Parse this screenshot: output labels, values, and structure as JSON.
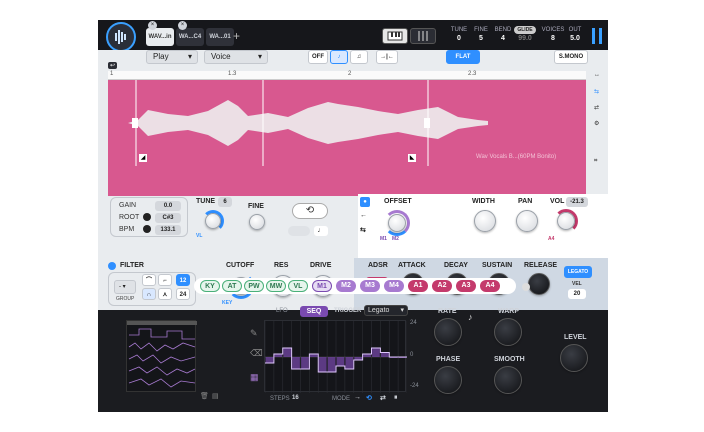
{
  "header": {
    "tabs": [
      {
        "label": "WAV...in",
        "active": true
      },
      {
        "label": "WA...C4",
        "active": false
      },
      {
        "label": "WA...01",
        "active": false
      }
    ],
    "add_label": "+",
    "params": [
      {
        "label": "TUNE",
        "value": "0"
      },
      {
        "label": "FINE",
        "value": "5"
      },
      {
        "label": "BEND",
        "value": "4"
      },
      {
        "label": "VOICES",
        "value": "8"
      },
      {
        "label": "OUT",
        "value": "5.0"
      }
    ],
    "glide_label": "GLIDE",
    "glide_value": "99.0"
  },
  "controls": {
    "play_mode": "Play",
    "voice_mode": "Voice",
    "off_label": "OFF",
    "flat_label": "FLAT",
    "smono_label": "S.MONO"
  },
  "ruler": {
    "marks": [
      "1",
      "1.3",
      "2",
      "2.3"
    ]
  },
  "wave": {
    "sample_name": "Wav Vocals B...(60PM Bonito)"
  },
  "sample": {
    "gain_label": "GAIN",
    "gain_value": "0.0",
    "root_label": "ROOT",
    "root_value": "C#3",
    "bpm_label": "BPM",
    "bpm_value": "133.1",
    "tune_label": "TUNE",
    "tune_value": "6",
    "fine_label": "FINE",
    "vl_label": "VL"
  },
  "offset": {
    "label": "OFFSET",
    "m1": "M1",
    "m2": "M2",
    "width_label": "WIDTH",
    "pan_label": "PAN",
    "vol_label": "VOL",
    "vol_value": "-21.3",
    "a4_label": "A4"
  },
  "filter": {
    "label": "FILTER",
    "group_label": "GROUP",
    "group_value": "-",
    "slope_12": "12",
    "slope_24": "24",
    "cutoff_label": "CUTOFF",
    "res_label": "RES",
    "drive_label": "DRIVE",
    "key_label": "KEY"
  },
  "adsr": {
    "label": "ADSR",
    "env_value": "A1",
    "attack_label": "ATTACK",
    "decay_label": "DECAY",
    "sustain_label": "SUSTAIN",
    "release_label": "RELEASE",
    "legato_label": "LEGATO",
    "vel_label": "VEL",
    "vel_value": "20"
  },
  "mod_tabs": [
    "KY",
    "AT",
    "PW",
    "MW",
    "VL",
    "M1",
    "M2",
    "M3",
    "M4",
    "A1",
    "A2",
    "A3",
    "A4"
  ],
  "lfo": {
    "lfo_label": "LFO",
    "seq_label": "SEQ",
    "trigger_label": "TRIGGER",
    "trigger_value": "Legato",
    "axis_top": "24",
    "axis_mid": "0",
    "axis_bottom": "-24",
    "steps_label": "STEPS",
    "steps_value": "16",
    "mode_label": "MODE",
    "step_values": [
      -4,
      2,
      6,
      -8,
      -8,
      2,
      -10,
      -10,
      -6,
      -8,
      -2,
      2,
      6,
      3,
      0,
      0
    ],
    "rate_label": "RATE",
    "warp_label": "WARP",
    "phase_label": "PHASE",
    "smooth_label": "SMOOTH",
    "level_label": "LEVEL"
  },
  "colors": {
    "accent_blue": "#2f8fff",
    "wave_pink": "#d8588f",
    "mod_purple": "#a77ad0",
    "mod_red": "#c43a6c",
    "mod_green": "#4ab07a"
  }
}
